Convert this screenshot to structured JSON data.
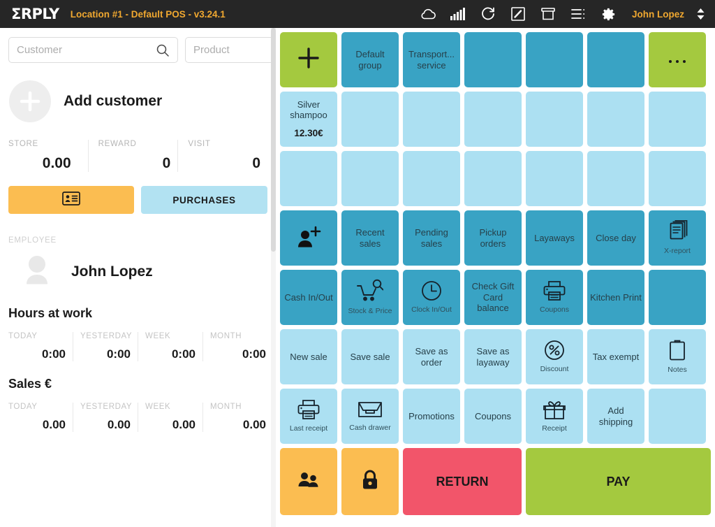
{
  "header": {
    "logo": "ΣRPLY",
    "title": "Location #1 - Default POS - v3.24.1",
    "username": "John Lopez",
    "icons": [
      "cloud-icon",
      "signal-icon",
      "refresh-icon",
      "signature-icon",
      "archive-icon",
      "list-icon",
      "gear-icon",
      "user-chevron-icon"
    ]
  },
  "left": {
    "search": {
      "customer_placeholder": "Customer",
      "customer_value": "",
      "product_placeholder": "Product",
      "product_value": ""
    },
    "add_customer_label": "Add customer",
    "stats": [
      {
        "label": "STORE",
        "value": "0.00"
      },
      {
        "label": "REWARD",
        "value": "0"
      },
      {
        "label": "VISIT",
        "value": "0"
      }
    ],
    "card_button_label": "",
    "purchases_button_label": "PURCHASES",
    "employee_section_label": "EMPLOYEE",
    "employee_name": "John Lopez",
    "hours_title": "Hours at work",
    "hours": [
      {
        "label": "TODAY",
        "value": "0:00"
      },
      {
        "label": "YESTERDAY",
        "value": "0:00"
      },
      {
        "label": "WEEK",
        "value": "0:00"
      },
      {
        "label": "MONTH",
        "value": "0:00"
      }
    ],
    "sales_title": "Sales €",
    "sales": [
      {
        "label": "TODAY",
        "value": "0.00"
      },
      {
        "label": "YESTERDAY",
        "value": "0.00"
      },
      {
        "label": "WEEK",
        "value": "0.00"
      },
      {
        "label": "MONTH",
        "value": "0.00"
      }
    ]
  },
  "right": {
    "tiles": [
      {
        "name": "add-group-button",
        "color": "green",
        "glyph": "plus",
        "label": ""
      },
      {
        "name": "group-default-group",
        "color": "blue",
        "label": "Default group"
      },
      {
        "name": "group-transport-service",
        "color": "blue",
        "label": "Transport... service"
      },
      {
        "name": "group-empty-1",
        "color": "blue",
        "label": ""
      },
      {
        "name": "group-empty-2",
        "color": "blue",
        "label": ""
      },
      {
        "name": "group-empty-3",
        "color": "blue",
        "label": ""
      },
      {
        "name": "more-groups-button",
        "color": "green",
        "glyph": "dots",
        "label": ""
      },
      {
        "name": "product-silver-shampoo",
        "color": "lblue",
        "label": "Silver shampoo",
        "price": "12.30€"
      },
      {
        "name": "product-empty-1",
        "color": "lblue",
        "label": ""
      },
      {
        "name": "product-empty-2",
        "color": "lblue",
        "label": ""
      },
      {
        "name": "product-empty-3",
        "color": "lblue",
        "label": ""
      },
      {
        "name": "product-empty-4",
        "color": "lblue",
        "label": ""
      },
      {
        "name": "product-empty-5",
        "color": "lblue",
        "label": ""
      },
      {
        "name": "product-empty-6",
        "color": "lblue",
        "label": ""
      },
      {
        "name": "product-empty-7",
        "color": "lblue",
        "label": ""
      },
      {
        "name": "product-empty-8",
        "color": "lblue",
        "label": ""
      },
      {
        "name": "product-empty-9",
        "color": "lblue",
        "label": ""
      },
      {
        "name": "product-empty-10",
        "color": "lblue",
        "label": ""
      },
      {
        "name": "product-empty-11",
        "color": "lblue",
        "label": ""
      },
      {
        "name": "product-empty-12",
        "color": "lblue",
        "label": ""
      },
      {
        "name": "product-empty-13",
        "color": "lblue",
        "label": ""
      },
      {
        "name": "add-customer-button",
        "color": "blue",
        "glyph": "user-plus",
        "label": ""
      },
      {
        "name": "recent-sales-button",
        "color": "blue",
        "label": "Recent sales"
      },
      {
        "name": "pending-sales-button",
        "color": "blue",
        "label": "Pending sales"
      },
      {
        "name": "pickup-orders-button",
        "color": "blue",
        "label": "Pickup orders"
      },
      {
        "name": "layaways-button",
        "color": "blue",
        "label": "Layaways"
      },
      {
        "name": "close-day-button",
        "color": "blue",
        "label": "Close day"
      },
      {
        "name": "x-report-button",
        "color": "blue",
        "glyph": "report",
        "icon_label": "X-report"
      },
      {
        "name": "cash-in-out-button",
        "color": "blue",
        "label": "Cash In/Out"
      },
      {
        "name": "stock-price-button",
        "color": "blue",
        "glyph": "cart-search",
        "icon_label": "Stock & Price"
      },
      {
        "name": "clock-in-out-button",
        "color": "blue",
        "glyph": "clock",
        "icon_label": "Clock In/Out"
      },
      {
        "name": "check-gift-card-balance-button",
        "color": "blue",
        "label": "Check Gift Card balance"
      },
      {
        "name": "coupons-print-button",
        "color": "blue",
        "glyph": "printer",
        "icon_label": "Coupons"
      },
      {
        "name": "kitchen-print-button",
        "color": "blue",
        "label": "Kitchen Print"
      },
      {
        "name": "function-empty-1",
        "color": "blue",
        "label": ""
      },
      {
        "name": "new-sale-button",
        "color": "lblue",
        "label": "New sale"
      },
      {
        "name": "save-sale-button",
        "color": "lblue",
        "label": "Save sale"
      },
      {
        "name": "save-as-order-button",
        "color": "lblue",
        "label": "Save as order"
      },
      {
        "name": "save-as-layaway-button",
        "color": "lblue",
        "label": "Save as layaway"
      },
      {
        "name": "discount-button",
        "color": "lblue",
        "glyph": "percent",
        "icon_label": "Discount"
      },
      {
        "name": "tax-exempt-button",
        "color": "lblue",
        "label": "Tax exempt"
      },
      {
        "name": "notes-button",
        "color": "lblue",
        "glyph": "clipboard",
        "icon_label": "Notes"
      },
      {
        "name": "last-receipt-button",
        "color": "lblue",
        "glyph": "printer",
        "icon_label": "Last receipt"
      },
      {
        "name": "cash-drawer-button",
        "color": "lblue",
        "glyph": "drawer",
        "icon_label": "Cash drawer"
      },
      {
        "name": "promotions-button",
        "color": "lblue",
        "label": "Promotions"
      },
      {
        "name": "coupons-button",
        "color": "lblue",
        "label": "Coupons"
      },
      {
        "name": "receipt-gift-button",
        "color": "lblue",
        "glyph": "gift",
        "icon_label": "Receipt"
      },
      {
        "name": "add-shipping-button",
        "color": "lblue",
        "label": "Add shipping"
      },
      {
        "name": "function-empty-2",
        "color": "lblue",
        "label": ""
      }
    ],
    "bottom": {
      "switch_user_label": "",
      "lock_label": "",
      "return_label": "RETURN",
      "pay_label": "PAY"
    }
  },
  "colors": {
    "header_bg": "#262626",
    "accent_orange": "#f0a830",
    "tile_green": "#a4c93f",
    "tile_blue": "#39a3c4",
    "tile_light_blue": "#ace0f2",
    "tile_orange": "#fbbd51",
    "tile_red": "#f2556a"
  }
}
